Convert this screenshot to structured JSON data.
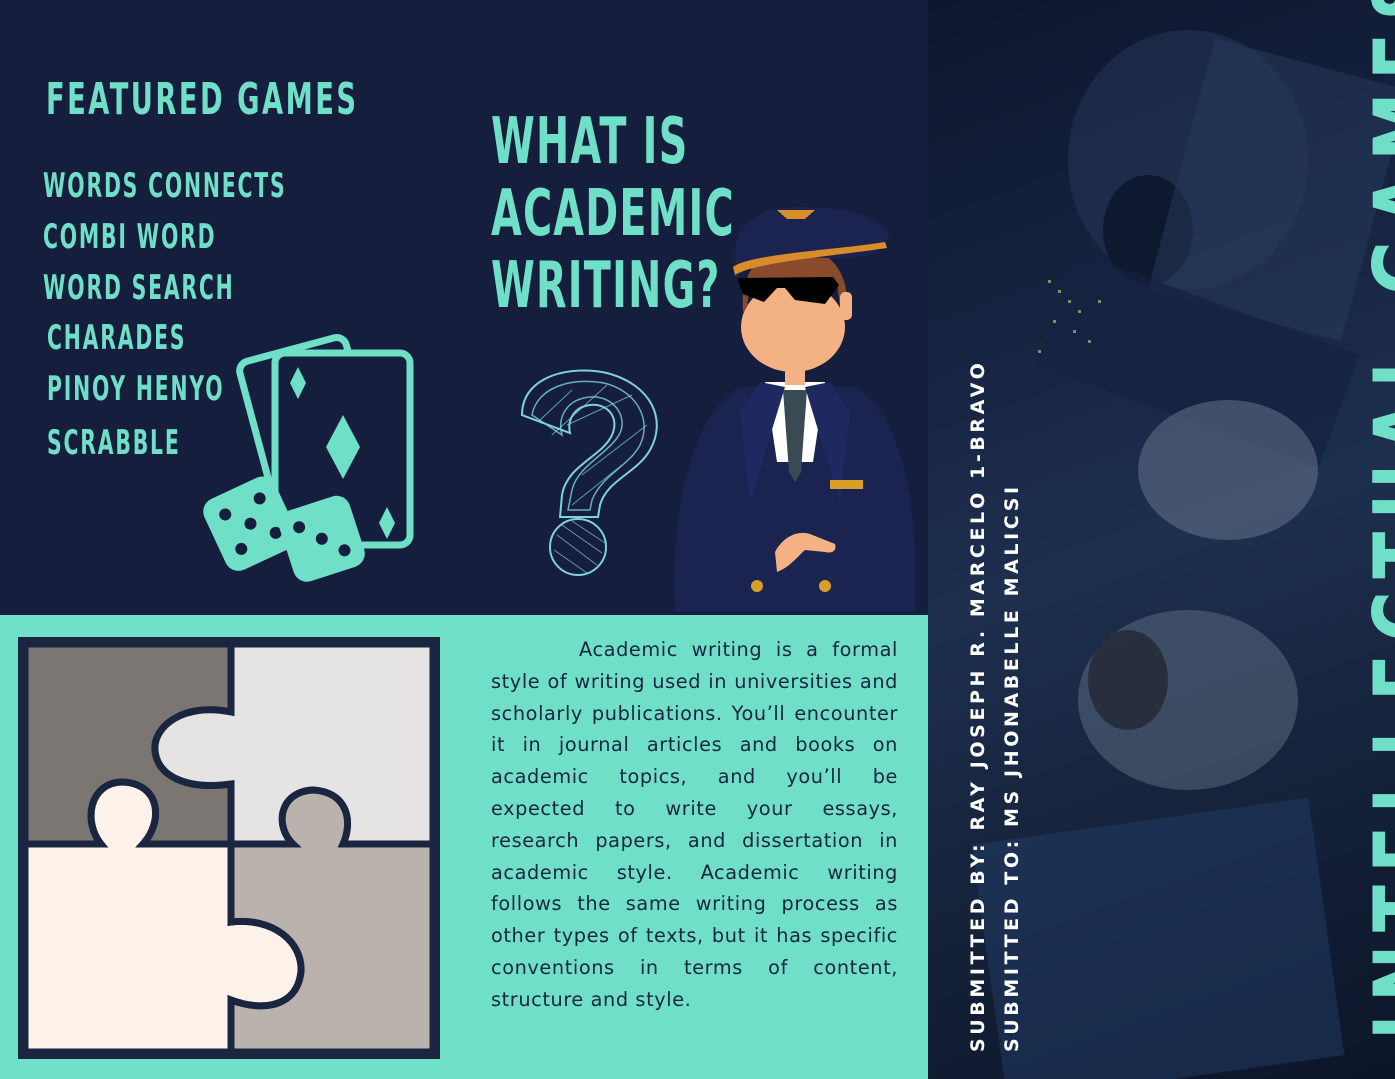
{
  "featured": {
    "title": "FEATURED GAMES",
    "games": [
      "WORDS CONNECTS",
      "COMBI WORD",
      "WORD SEARCH",
      "CHARADES",
      "PINOY HENYO",
      "SCRABBLE"
    ]
  },
  "question": {
    "line1": "WHAT IS",
    "line2": "ACADEMIC",
    "line3": "WRITING?"
  },
  "description": "Academic writing is a formal style of writing used in universities and scholarly publications. You’ll encounter it in journal articles and books on academic topics, and you’ll be expected to write your essays, research papers, and dissertation in academic style. Academic writing follows the same writing process as other types of texts, but it has specific conventions in terms of content, structure and style.",
  "cover": {
    "title": "INTELLECTUAL GAMES",
    "submitted_by": "SUBMITTED BY: RAY JOSEPH R. MARCELO 1-BRAVO",
    "submitted_to": "SUBMITTED TO: MS JHONABELLE MALICSI"
  },
  "icons": {
    "cards": "playing-cards-and-dice-icon",
    "question": "question-mark-icon",
    "pilot": "pilot-illustration",
    "puzzle": "puzzle-icon",
    "cockpit": "cockpit-photo"
  },
  "colors": {
    "navy": "#151f3d",
    "mint": "#6fdfc7"
  }
}
